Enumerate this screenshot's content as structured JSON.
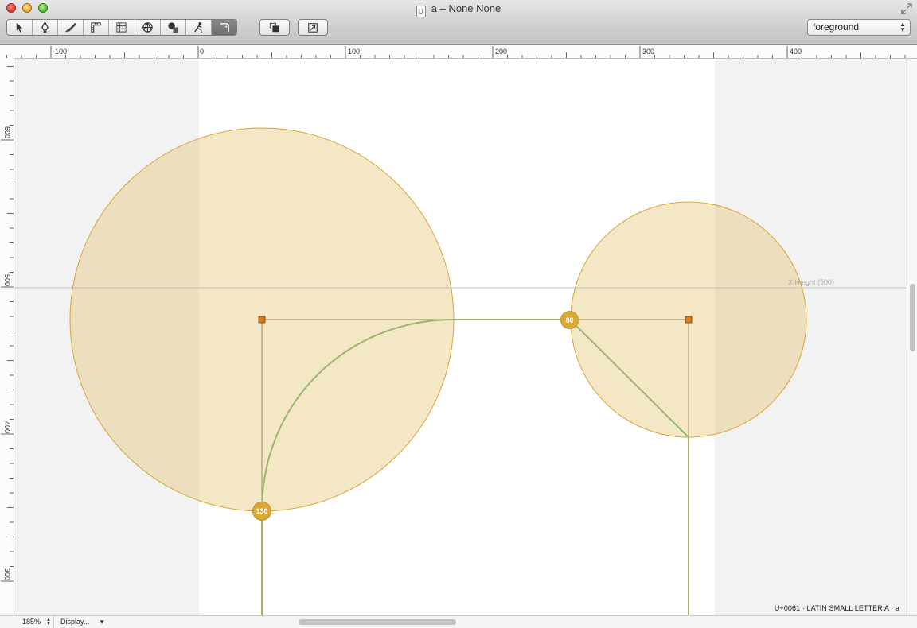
{
  "window": {
    "title": "a – None None",
    "doc_icon_glyph": "U"
  },
  "toolbar": {
    "tools": [
      {
        "name": "select-tool-icon",
        "label": "Select"
      },
      {
        "name": "pen-tool-icon",
        "label": "Pen"
      },
      {
        "name": "knife-tool-icon",
        "label": "Knife"
      },
      {
        "name": "ruler-tool-icon",
        "label": "Ruler"
      },
      {
        "name": "grid-tool-icon",
        "label": "Grid"
      },
      {
        "name": "anchor-tool-icon",
        "label": "Anchor"
      },
      {
        "name": "shapes-tool-icon",
        "label": "Shapes"
      },
      {
        "name": "skeleton-tool-icon",
        "label": "Skeleton"
      },
      {
        "name": "corner-tool-icon",
        "label": "Corner",
        "active": true
      }
    ],
    "layer_select": {
      "value": "foreground"
    }
  },
  "ruler": {
    "h_labels": [
      "-100",
      "0",
      "100",
      "200",
      "300",
      "400"
    ],
    "v_labels": [
      "600",
      "500",
      "400",
      "300"
    ]
  },
  "canvas": {
    "xheight_label": "X Height (500)",
    "radius_badges": [
      {
        "value": "130"
      },
      {
        "value": "80"
      }
    ],
    "glyph_info": "U+0061 · LATIN SMALL LETTER A · a"
  },
  "status": {
    "zoom": "185%",
    "display": "Display..."
  },
  "colors": {
    "circle_fill": "#f1e3bc",
    "circle_stroke": "#dba43a",
    "path_green": "#9bb66a",
    "handle_orange": "#e07a12",
    "badge": "#d9a938"
  }
}
